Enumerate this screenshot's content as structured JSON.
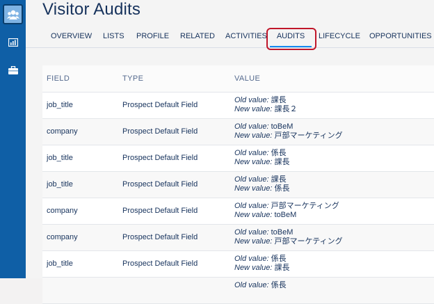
{
  "page": {
    "title": "Visitor Audits"
  },
  "sidebar": {
    "items": [
      {
        "icon": "prospects-icon",
        "active": true
      },
      {
        "icon": "reports-icon",
        "active": false
      },
      {
        "icon": "briefcase-icon",
        "active": false
      }
    ]
  },
  "tabs": [
    {
      "label": "OVERVIEW"
    },
    {
      "label": "LISTS"
    },
    {
      "label": "PROFILE"
    },
    {
      "label": "RELATED"
    },
    {
      "label": "ACTIVITIES"
    },
    {
      "label": "AUDITS",
      "active": true
    },
    {
      "label": "LIFECYCLE"
    },
    {
      "label": "OPPORTUNITIES"
    }
  ],
  "table": {
    "headers": {
      "field": "FIELD",
      "type": "TYPE",
      "value": "VALUE"
    },
    "old_label": "Old value:",
    "new_label": "New value:",
    "rows": [
      {
        "field": "job_title",
        "type": "Prospect Default Field",
        "old": "課長",
        "new": "課長２"
      },
      {
        "field": "company",
        "type": "Prospect Default Field",
        "old": "toBeM",
        "new": "戸部マーケティング"
      },
      {
        "field": "job_title",
        "type": "Prospect Default Field",
        "old": "係長",
        "new": "課長"
      },
      {
        "field": "job_title",
        "type": "Prospect Default Field",
        "old": "課長",
        "new": "係長"
      },
      {
        "field": "company",
        "type": "Prospect Default Field",
        "old": "戸部マーケティング",
        "new": "toBeM"
      },
      {
        "field": "company",
        "type": "Prospect Default Field",
        "old": "toBeM",
        "new": "戸部マーケティング"
      },
      {
        "field": "job_title",
        "type": "Prospect Default Field",
        "old": "係長",
        "new": "課長"
      },
      {
        "field": "",
        "type": "",
        "old": "係長",
        "new": ""
      }
    ]
  }
}
